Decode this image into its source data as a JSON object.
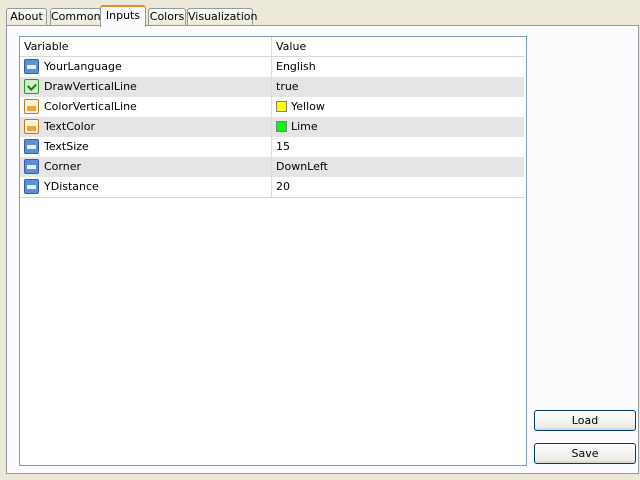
{
  "tabs": [
    {
      "label": "About"
    },
    {
      "label": "Common"
    },
    {
      "label": "Inputs",
      "active": true
    },
    {
      "label": "Colors"
    },
    {
      "label": "Visualization"
    }
  ],
  "grid": {
    "columns": [
      "Variable",
      "Value"
    ],
    "rows": [
      {
        "variable": "YourLanguage",
        "value": "English",
        "icon": "number-icon"
      },
      {
        "variable": "DrawVerticalLine",
        "value": "true",
        "icon": "boolean-icon"
      },
      {
        "variable": "ColorVerticalLine",
        "value": "Yellow",
        "icon": "color-icon",
        "swatch": "#ffff00"
      },
      {
        "variable": "TextColor",
        "value": "Lime",
        "icon": "color-icon",
        "swatch": "#00ff00"
      },
      {
        "variable": "TextSize",
        "value": "15",
        "icon": "number-icon"
      },
      {
        "variable": "Corner",
        "value": "DownLeft",
        "icon": "number-icon"
      },
      {
        "variable": "YDistance",
        "value": "20",
        "icon": "number-icon"
      }
    ]
  },
  "buttons": {
    "load": "Load",
    "save": "Save"
  },
  "colors": {
    "accent_tab": "#e68b2c",
    "dialog_bg": "#ece9d8",
    "row_alt": "#e5e5e5"
  }
}
